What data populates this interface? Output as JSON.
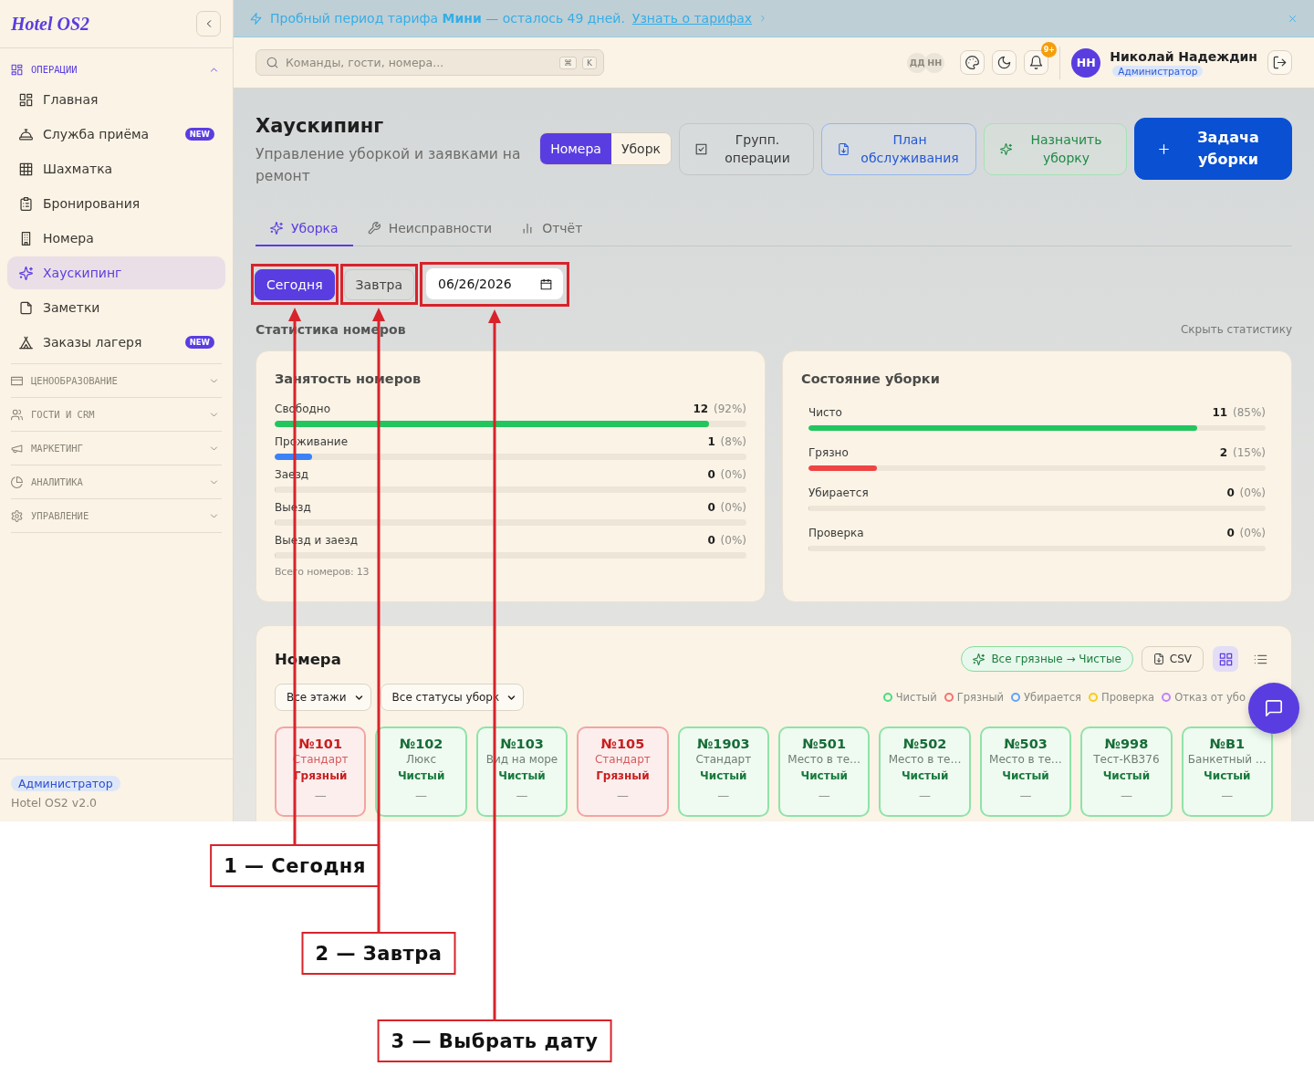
{
  "sidebar": {
    "logo": "Hotel OS2",
    "groups": [
      {
        "label": "ОПЕРАЦИИ",
        "expanded": true,
        "items": [
          {
            "label": "Главная",
            "selected": false
          },
          {
            "label": "Служба приёма",
            "selected": false,
            "badge": "NEW"
          },
          {
            "label": "Шахматка",
            "selected": false
          },
          {
            "label": "Бронирования",
            "selected": false
          },
          {
            "label": "Номера",
            "selected": false
          },
          {
            "label": "Хаускипинг",
            "selected": true
          },
          {
            "label": "Заметки",
            "selected": false
          },
          {
            "label": "Заказы лагеря",
            "selected": false,
            "badge": "NEW"
          }
        ]
      },
      {
        "label": "ЦЕНООБРАЗОВАНИЕ",
        "expanded": false
      },
      {
        "label": "ГОСТИ И CRM",
        "expanded": false
      },
      {
        "label": "МАРКЕТИНГ",
        "expanded": false
      },
      {
        "label": "АНАЛИТИКА",
        "expanded": false
      },
      {
        "label": "УПРАВЛЕНИЕ",
        "expanded": false
      }
    ],
    "footer": {
      "role": "Администратор",
      "version": "Hotel OS2 v2.0"
    }
  },
  "banner": {
    "text": "Пробный период тарифа **Мини** — осталось 49 дней.",
    "link": "Узнать о тарифах"
  },
  "topbar": {
    "search": {
      "placeholder": "Команды, гости, номера...",
      "keys": [
        "⌘",
        "K"
      ]
    },
    "presence": [
      "ДД",
      "НН"
    ],
    "notification_count": "9+",
    "user": {
      "initials": "НН",
      "name": "Николай Надеждин",
      "role": "Администратор"
    }
  },
  "header": {
    "title": "Хаускипинг",
    "subtitle": "Управление уборкой и заявками на ремонт",
    "view_switch": [
      {
        "label": "Номера",
        "selected": true
      },
      {
        "label": "Уборк",
        "selected": false
      }
    ],
    "actions": [
      {
        "label": "Групп. операции",
        "kind": "neutral"
      },
      {
        "label": "План обслуживания",
        "kind": "info"
      },
      {
        "label": "Назначить уборку",
        "kind": "success"
      },
      {
        "label": "Задача уборки",
        "kind": "primary"
      }
    ]
  },
  "tabs": [
    {
      "label": "Уборка",
      "selected": true
    },
    {
      "label": "Неисправности",
      "selected": false
    },
    {
      "label": "Отчёт",
      "selected": false
    }
  ],
  "date_filter": {
    "options": [
      {
        "label": "Сегодня",
        "selected": true
      },
      {
        "label": "Завтра",
        "selected": false
      }
    ],
    "date": "06/26/2026"
  },
  "stats": {
    "title": "Статистика номеров",
    "hide_link": "Скрыть статистику",
    "cards": [
      {
        "title": "Занятость номеров",
        "rows": [
          {
            "label": "Свободно",
            "count": "12",
            "percent": "(92%)",
            "level": 0.92,
            "color": "#22c55e"
          },
          {
            "label": "Проживание",
            "count": "1",
            "percent": "(8%)",
            "level": 0.08,
            "color": "#3b82f6"
          },
          {
            "label": "Заезд",
            "count": "0",
            "percent": "(0%)",
            "level": 0
          },
          {
            "label": "Выезд",
            "count": "0",
            "percent": "(0%)",
            "level": 0
          },
          {
            "label": "Выезд и заезд",
            "count": "0",
            "percent": "(0%)",
            "level": 0
          }
        ],
        "total": "Всего номеров: 13"
      },
      {
        "title": "Состояние уборки",
        "rows": [
          {
            "label": "Чисто",
            "count": "11",
            "percent": "(85%)",
            "level": 0.85,
            "color": "#22c55e"
          },
          {
            "label": "Грязно",
            "count": "2",
            "percent": "(15%)",
            "level": 0.15,
            "color": "#ef4444"
          },
          {
            "label": "Убирается",
            "count": "0",
            "percent": "(0%)",
            "level": 0
          },
          {
            "label": "Проверка",
            "count": "0",
            "percent": "(0%)",
            "level": 0
          }
        ]
      }
    ]
  },
  "rooms": {
    "title": "Номера",
    "bulk_action": "Все грязные → Чистые",
    "export": "CSV",
    "views": [
      {
        "kind": "grid",
        "selected": true
      },
      {
        "kind": "list",
        "selected": false
      }
    ],
    "filters": [
      "Все этажи",
      "Все статусы уборк"
    ],
    "legend": [
      {
        "label": "Чистый",
        "color": "#4ade80"
      },
      {
        "label": "Грязный",
        "color": "#f87171"
      },
      {
        "label": "Убирается",
        "color": "#60a5fa"
      },
      {
        "label": "Проверка",
        "color": "#facc15"
      },
      {
        "label": "Отказ от убо",
        "color": "#c084fc"
      }
    ],
    "cards": [
      {
        "number": "№101",
        "type": "Стандарт",
        "status": "Грязный",
        "kind": "dirty",
        "detail": "—"
      },
      {
        "number": "№102",
        "type": "Люкс",
        "status": "Чистый",
        "kind": "clean",
        "detail": "—"
      },
      {
        "number": "№103",
        "type": "Вид на море",
        "status": "Чистый",
        "kind": "clean",
        "detail": "—"
      },
      {
        "number": "№105",
        "type": "Стандарт",
        "status": "Грязный",
        "kind": "dirty",
        "detail": "—"
      },
      {
        "number": "№1903",
        "type": "Стандарт",
        "status": "Чистый",
        "kind": "clean",
        "detail": "—"
      },
      {
        "number": "№501",
        "type": "Место в те…",
        "status": "Чистый",
        "kind": "clean",
        "detail": "—"
      },
      {
        "number": "№502",
        "type": "Место в те…",
        "status": "Чистый",
        "kind": "clean",
        "detail": "—"
      },
      {
        "number": "№503",
        "type": "Место в те…",
        "status": "Чистый",
        "kind": "clean",
        "detail": "—"
      },
      {
        "number": "№998",
        "type": "Тест-КВ376",
        "status": "Чистый",
        "kind": "clean",
        "detail": "—"
      },
      {
        "number": "№В1",
        "type": "Банкетный …",
        "status": "Чистый",
        "kind": "clean",
        "detail": "—"
      }
    ]
  },
  "annotations": [
    "1 — Сегодня",
    "2 — Завтра",
    "3 — Выбрать дату"
  ]
}
